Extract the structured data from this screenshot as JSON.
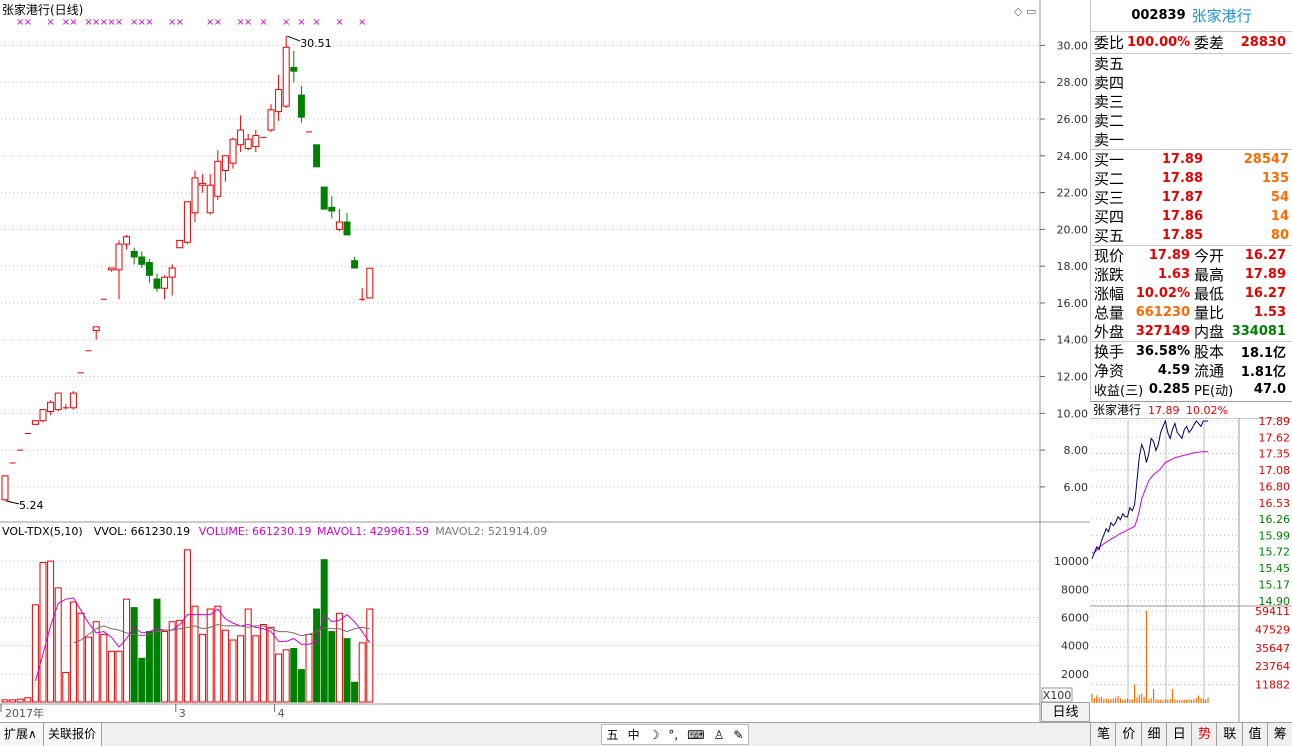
{
  "chart_data": {
    "type": "candlestick",
    "title": "张家港行(日线)",
    "price_ylim": [
      4.2,
      31.6
    ],
    "price_ticks": [
      "30.00",
      "28.00",
      "26.00",
      "24.00",
      "22.00",
      "20.00",
      "18.00",
      "16.00",
      "14.00",
      "12.00",
      "10.00",
      "8.00",
      "6.00"
    ],
    "low_annotation": "5.24",
    "high_annotation": "30.51",
    "candles": [
      {
        "o": 5.3,
        "h": 6.6,
        "l": 5.24,
        "c": 6.6
      },
      {
        "o": 7.3,
        "h": 7.3,
        "l": 7.3,
        "c": 7.3
      },
      {
        "o": 8.0,
        "h": 8.0,
        "l": 8.0,
        "c": 8.0
      },
      {
        "o": 8.9,
        "h": 8.9,
        "l": 8.9,
        "c": 8.9
      },
      {
        "o": 9.4,
        "h": 9.6,
        "l": 9.4,
        "c": 9.6
      },
      {
        "o": 9.6,
        "h": 10.2,
        "l": 9.5,
        "c": 10.2
      },
      {
        "o": 10.1,
        "h": 10.7,
        "l": 9.9,
        "c": 10.6
      },
      {
        "o": 10.2,
        "h": 11.1,
        "l": 10.1,
        "c": 11.1
      },
      {
        "o": 10.3,
        "h": 10.5,
        "l": 10.2,
        "c": 10.3
      },
      {
        "o": 10.3,
        "h": 11.2,
        "l": 10.2,
        "c": 11.1
      },
      {
        "o": 12.2,
        "h": 12.2,
        "l": 12.2,
        "c": 12.2
      },
      {
        "o": 13.4,
        "h": 13.4,
        "l": 13.4,
        "c": 13.4
      },
      {
        "o": 14.5,
        "h": 14.7,
        "l": 14.0,
        "c": 14.7
      },
      {
        "o": 16.2,
        "h": 16.2,
        "l": 16.2,
        "c": 16.2
      },
      {
        "o": 17.8,
        "h": 17.9,
        "l": 17.7,
        "c": 17.9
      },
      {
        "o": 17.8,
        "h": 19.4,
        "l": 16.2,
        "c": 19.2
      },
      {
        "o": 19.2,
        "h": 19.7,
        "l": 18.9,
        "c": 19.6
      },
      {
        "o": 18.8,
        "h": 19.0,
        "l": 18.1,
        "c": 18.5
      },
      {
        "o": 18.5,
        "h": 18.8,
        "l": 17.9,
        "c": 18.1
      },
      {
        "o": 18.2,
        "h": 18.4,
        "l": 17.1,
        "c": 17.5
      },
      {
        "o": 17.3,
        "h": 17.6,
        "l": 16.6,
        "c": 16.8
      },
      {
        "o": 16.8,
        "h": 17.5,
        "l": 16.2,
        "c": 17.4
      },
      {
        "o": 17.4,
        "h": 18.1,
        "l": 16.4,
        "c": 17.9
      },
      {
        "o": 19.0,
        "h": 19.4,
        "l": 19.0,
        "c": 19.4
      },
      {
        "o": 19.3,
        "h": 21.5,
        "l": 19.2,
        "c": 21.5
      },
      {
        "o": 20.9,
        "h": 23.2,
        "l": 20.4,
        "c": 22.8
      },
      {
        "o": 22.4,
        "h": 23.0,
        "l": 22.0,
        "c": 22.5
      },
      {
        "o": 20.9,
        "h": 23.0,
        "l": 20.8,
        "c": 22.4
      },
      {
        "o": 21.8,
        "h": 24.3,
        "l": 21.6,
        "c": 23.7
      },
      {
        "o": 23.2,
        "h": 24.0,
        "l": 22.6,
        "c": 24.0
      },
      {
        "o": 23.6,
        "h": 25.0,
        "l": 23.3,
        "c": 24.9
      },
      {
        "o": 24.6,
        "h": 26.2,
        "l": 24.2,
        "c": 25.4
      },
      {
        "o": 24.4,
        "h": 25.2,
        "l": 24.3,
        "c": 24.9
      },
      {
        "o": 24.5,
        "h": 25.4,
        "l": 24.2,
        "c": 25.1
      },
      {
        "o": 25.0,
        "h": 25.0,
        "l": 25.0,
        "c": 25.0
      },
      {
        "o": 25.4,
        "h": 26.8,
        "l": 25.3,
        "c": 26.5
      },
      {
        "o": 26.4,
        "h": 28.4,
        "l": 25.9,
        "c": 27.6
      },
      {
        "o": 26.7,
        "h": 30.51,
        "l": 26.6,
        "c": 29.9
      },
      {
        "o": 28.8,
        "h": 29.7,
        "l": 28.0,
        "c": 28.6
      },
      {
        "o": 27.3,
        "h": 27.8,
        "l": 25.8,
        "c": 26.1
      },
      {
        "o": 25.3,
        "h": 25.3,
        "l": 25.3,
        "c": 25.3
      },
      {
        "o": 24.6,
        "h": 24.6,
        "l": 23.4,
        "c": 23.4
      },
      {
        "o": 22.3,
        "h": 22.3,
        "l": 21.1,
        "c": 21.1
      },
      {
        "o": 21.2,
        "h": 21.8,
        "l": 20.6,
        "c": 21.0
      },
      {
        "o": 20.0,
        "h": 21.1,
        "l": 19.9,
        "c": 20.4
      },
      {
        "o": 20.4,
        "h": 20.9,
        "l": 19.7,
        "c": 19.7
      },
      {
        "o": 18.3,
        "h": 18.5,
        "l": 17.9,
        "c": 17.9
      },
      {
        "o": 16.2,
        "h": 16.8,
        "l": 16.1,
        "c": 16.2
      },
      {
        "o": 16.27,
        "h": 17.89,
        "l": 16.27,
        "c": 17.89
      }
    ],
    "x_markers": [
      {
        "index": 0,
        "text": "2017年"
      },
      {
        "index": 23,
        "text": "3"
      },
      {
        "index": 36,
        "text": "4"
      }
    ],
    "volume_panel": {
      "title": "VOL-TDX(5,10)",
      "vvol_label": "VVOL: 661230.19",
      "volume_label": "VOLUME: 661230.19",
      "mavol1_label": "MAVOL1: 429961.59",
      "mavol2_label": "MAVOL2: 521914.09",
      "ylim": [
        0,
        11500
      ],
      "ticks": [
        "10000",
        "8000",
        "6000",
        "4000",
        "2000"
      ],
      "unit": "X100",
      "values": [
        150,
        150,
        200,
        300,
        6900,
        9900,
        10000,
        8100,
        2100,
        7100,
        6300,
        4600,
        5700,
        4800,
        3600,
        3600,
        7300,
        6700,
        3100,
        5000,
        7300,
        5000,
        5700,
        5800,
        10800,
        6800,
        4800,
        6600,
        6800,
        5100,
        4400,
        4700,
        6600,
        4700,
        5500,
        5300,
        3400,
        3700,
        3800,
        2300,
        4800,
        6600,
        10100,
        5000,
        6300,
        4500,
        1400,
        4200,
        6600
      ],
      "mavol1": [
        null,
        null,
        null,
        null,
        1500,
        3400,
        5400,
        7000,
        7300,
        7400,
        6500,
        5600,
        4900,
        5000,
        4600,
        3900,
        4500,
        5300,
        4900,
        5000,
        5200,
        5100,
        5100,
        5500,
        6200,
        6200,
        6200,
        6200,
        6600,
        5900,
        5600,
        5400,
        5500,
        5300,
        5200,
        5000,
        4300,
        4300,
        4500,
        4100,
        4100,
        4300,
        6200,
        5700,
        5800,
        6200,
        5700,
        5000,
        4200
      ],
      "mavol2": [
        null,
        null,
        null,
        null,
        null,
        null,
        null,
        null,
        null,
        4200,
        4400,
        4800,
        5200,
        5400,
        5200,
        5100,
        4900,
        4800,
        4700,
        4800,
        5000,
        5100,
        5100,
        5200,
        5300,
        5400,
        5200,
        5300,
        5500,
        5400,
        5400,
        5400,
        5300,
        5400,
        5400,
        5200,
        5000,
        5000,
        4900,
        4700,
        4800,
        5000,
        5300,
        5200,
        5200,
        5000,
        5200,
        5300,
        5200
      ]
    },
    "signal_row": {
      "marker": "×",
      "color": "#d400d4"
    },
    "grid": "dotted"
  },
  "quote": {
    "code": "002839",
    "name": "张家港行",
    "ratio_label": "委比",
    "ratio_value": "100.00%",
    "diff_label": "委差",
    "diff_value": "28830",
    "asks": [
      {
        "label": "卖五",
        "price": "",
        "vol": ""
      },
      {
        "label": "卖四",
        "price": "",
        "vol": ""
      },
      {
        "label": "卖三",
        "price": "",
        "vol": ""
      },
      {
        "label": "卖二",
        "price": "",
        "vol": ""
      },
      {
        "label": "卖一",
        "price": "",
        "vol": ""
      }
    ],
    "bids": [
      {
        "label": "买一",
        "price": "17.89",
        "vol": "28547"
      },
      {
        "label": "买二",
        "price": "17.88",
        "vol": "135"
      },
      {
        "label": "买三",
        "price": "17.87",
        "vol": "54"
      },
      {
        "label": "买四",
        "price": "17.86",
        "vol": "14"
      },
      {
        "label": "买五",
        "price": "17.85",
        "vol": "80"
      }
    ],
    "stats": [
      {
        "l1": "现价",
        "v1": "17.89",
        "c1": "red",
        "l2": "今开",
        "v2": "16.27",
        "c2": "red"
      },
      {
        "l1": "涨跌",
        "v1": "1.63",
        "c1": "red",
        "l2": "最高",
        "v2": "17.89",
        "c2": "red"
      },
      {
        "l1": "涨幅",
        "v1": "10.02%",
        "c1": "red",
        "l2": "最低",
        "v2": "16.27",
        "c2": "red"
      },
      {
        "l1": "总量",
        "v1": "661230",
        "c1": "orange",
        "l2": "量比",
        "v2": "1.53",
        "c2": "red"
      },
      {
        "l1": "外盘",
        "v1": "327149",
        "c1": "red",
        "l2": "内盘",
        "v2": "334081",
        "c2": "green"
      }
    ],
    "fundamentals": [
      {
        "l1": "换手",
        "v1": "36.58%",
        "l2": "股本",
        "v2": "18.1亿"
      },
      {
        "l1": "净资",
        "v1": "4.59",
        "l2": "流通",
        "v2": "1.81亿"
      },
      {
        "l1": "收益(三)",
        "v1": "0.285",
        "l2": "PE(动)",
        "v2": "47.0"
      }
    ]
  },
  "intraday": {
    "name": "张家港行",
    "price": "17.89",
    "pct": "10.02%",
    "price_ticks": [
      "17.89",
      "17.62",
      "17.35",
      "17.08",
      "16.80",
      "16.53",
      "16.26",
      "15.99",
      "15.72",
      "15.45",
      "15.17",
      "14.90"
    ],
    "volume_ticks": [
      "59411",
      "47529",
      "35647",
      "23764",
      "11882"
    ],
    "price_line": [
      15.6,
      15.7,
      15.8,
      15.75,
      15.9,
      16.0,
      16.1,
      16.05,
      16.2,
      16.15,
      16.2,
      16.3,
      16.25,
      16.35,
      16.3,
      16.3,
      16.45,
      16.4,
      16.5,
      16.9,
      17.3,
      17.5,
      17.4,
      17.2,
      17.35,
      17.6,
      17.55,
      17.4,
      17.5,
      17.7,
      17.8,
      17.89,
      17.7,
      17.6,
      17.75,
      17.85,
      17.7,
      17.65,
      17.6,
      17.75,
      17.8,
      17.7,
      17.75,
      17.82,
      17.89,
      17.85,
      17.8,
      17.89,
      17.89,
      17.89
    ],
    "avg_line": [
      15.7,
      15.7,
      15.75,
      15.8,
      15.82,
      15.85,
      15.88,
      15.9,
      15.93,
      15.95,
      15.97,
      16.0,
      16.02,
      16.04,
      16.06,
      16.08,
      16.1,
      16.12,
      16.14,
      16.25,
      16.4,
      16.6,
      16.7,
      16.8,
      16.9,
      16.95,
      17.0,
      17.03,
      17.06,
      17.1,
      17.15,
      17.2,
      17.22,
      17.24,
      17.26,
      17.28,
      17.29,
      17.3,
      17.31,
      17.32,
      17.33,
      17.34,
      17.35,
      17.36,
      17.37,
      17.37,
      17.38,
      17.38,
      17.38,
      17.38
    ],
    "volumes": [
      6000,
      3000,
      5000,
      3500,
      4000,
      2500,
      3000,
      2200,
      2600,
      2800,
      3500,
      4500,
      3000,
      2000,
      2500,
      3000,
      2200,
      2400,
      12000,
      3500,
      5000,
      6000,
      4000,
      59411,
      2000,
      3000,
      9000,
      2500,
      2200,
      2000,
      1800,
      2400,
      2100,
      2600,
      9000,
      2300,
      2000,
      1800,
      2200,
      2000,
      1900,
      2500,
      2100,
      2400,
      3200,
      4800,
      3000,
      2600,
      2200,
      3500
    ]
  },
  "bottom": {
    "tab1": "扩展∧",
    "tab2": "关联报价",
    "ime_items": [
      "五",
      "中",
      "☽",
      "°,",
      "⌨",
      "♙",
      "✎"
    ],
    "period": "日线",
    "right_tabs": [
      "笔",
      "价",
      "细",
      "日",
      "势",
      "联",
      "值",
      "筹"
    ]
  },
  "colors": {
    "up": "#e60000",
    "down": "#008000",
    "ma1": "#d400d4",
    "ma2": "#7a6a6a",
    "grid": "#bdbdbd",
    "intraday_price": "#000066",
    "intraday_avg": "#d400d4",
    "intraday_vol": "#ff6a00"
  }
}
